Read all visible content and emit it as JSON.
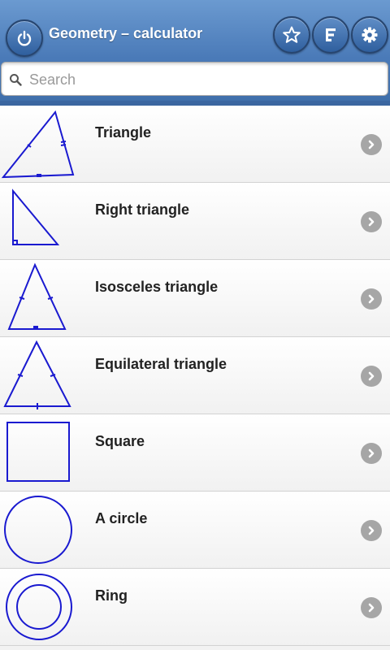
{
  "header": {
    "title": "Geometry – calculator",
    "buttons": [
      {
        "name": "power-button",
        "icon": "power-icon"
      },
      {
        "name": "favorites-button",
        "icon": "star-icon"
      },
      {
        "name": "menu-list-button",
        "icon": "list-menu-icon"
      },
      {
        "name": "settings-button",
        "icon": "gear-icon"
      }
    ]
  },
  "search": {
    "placeholder": "Search",
    "value": ""
  },
  "list": {
    "items": [
      {
        "label": "Triangle",
        "icon": "triangle-shape-icon"
      },
      {
        "label": "Right triangle",
        "icon": "right-triangle-shape-icon"
      },
      {
        "label": "Isosceles triangle",
        "icon": "isosceles-triangle-shape-icon"
      },
      {
        "label": "Equilateral triangle",
        "icon": "equilateral-triangle-shape-icon"
      },
      {
        "label": "Square",
        "icon": "square-shape-icon"
      },
      {
        "label": "A circle",
        "icon": "circle-shape-icon"
      },
      {
        "label": "Ring",
        "icon": "ring-shape-icon"
      }
    ]
  },
  "colors": {
    "header": "#4a7ab8",
    "shape_stroke": "#1a1ad0",
    "chevron": "#a6a6a6"
  }
}
